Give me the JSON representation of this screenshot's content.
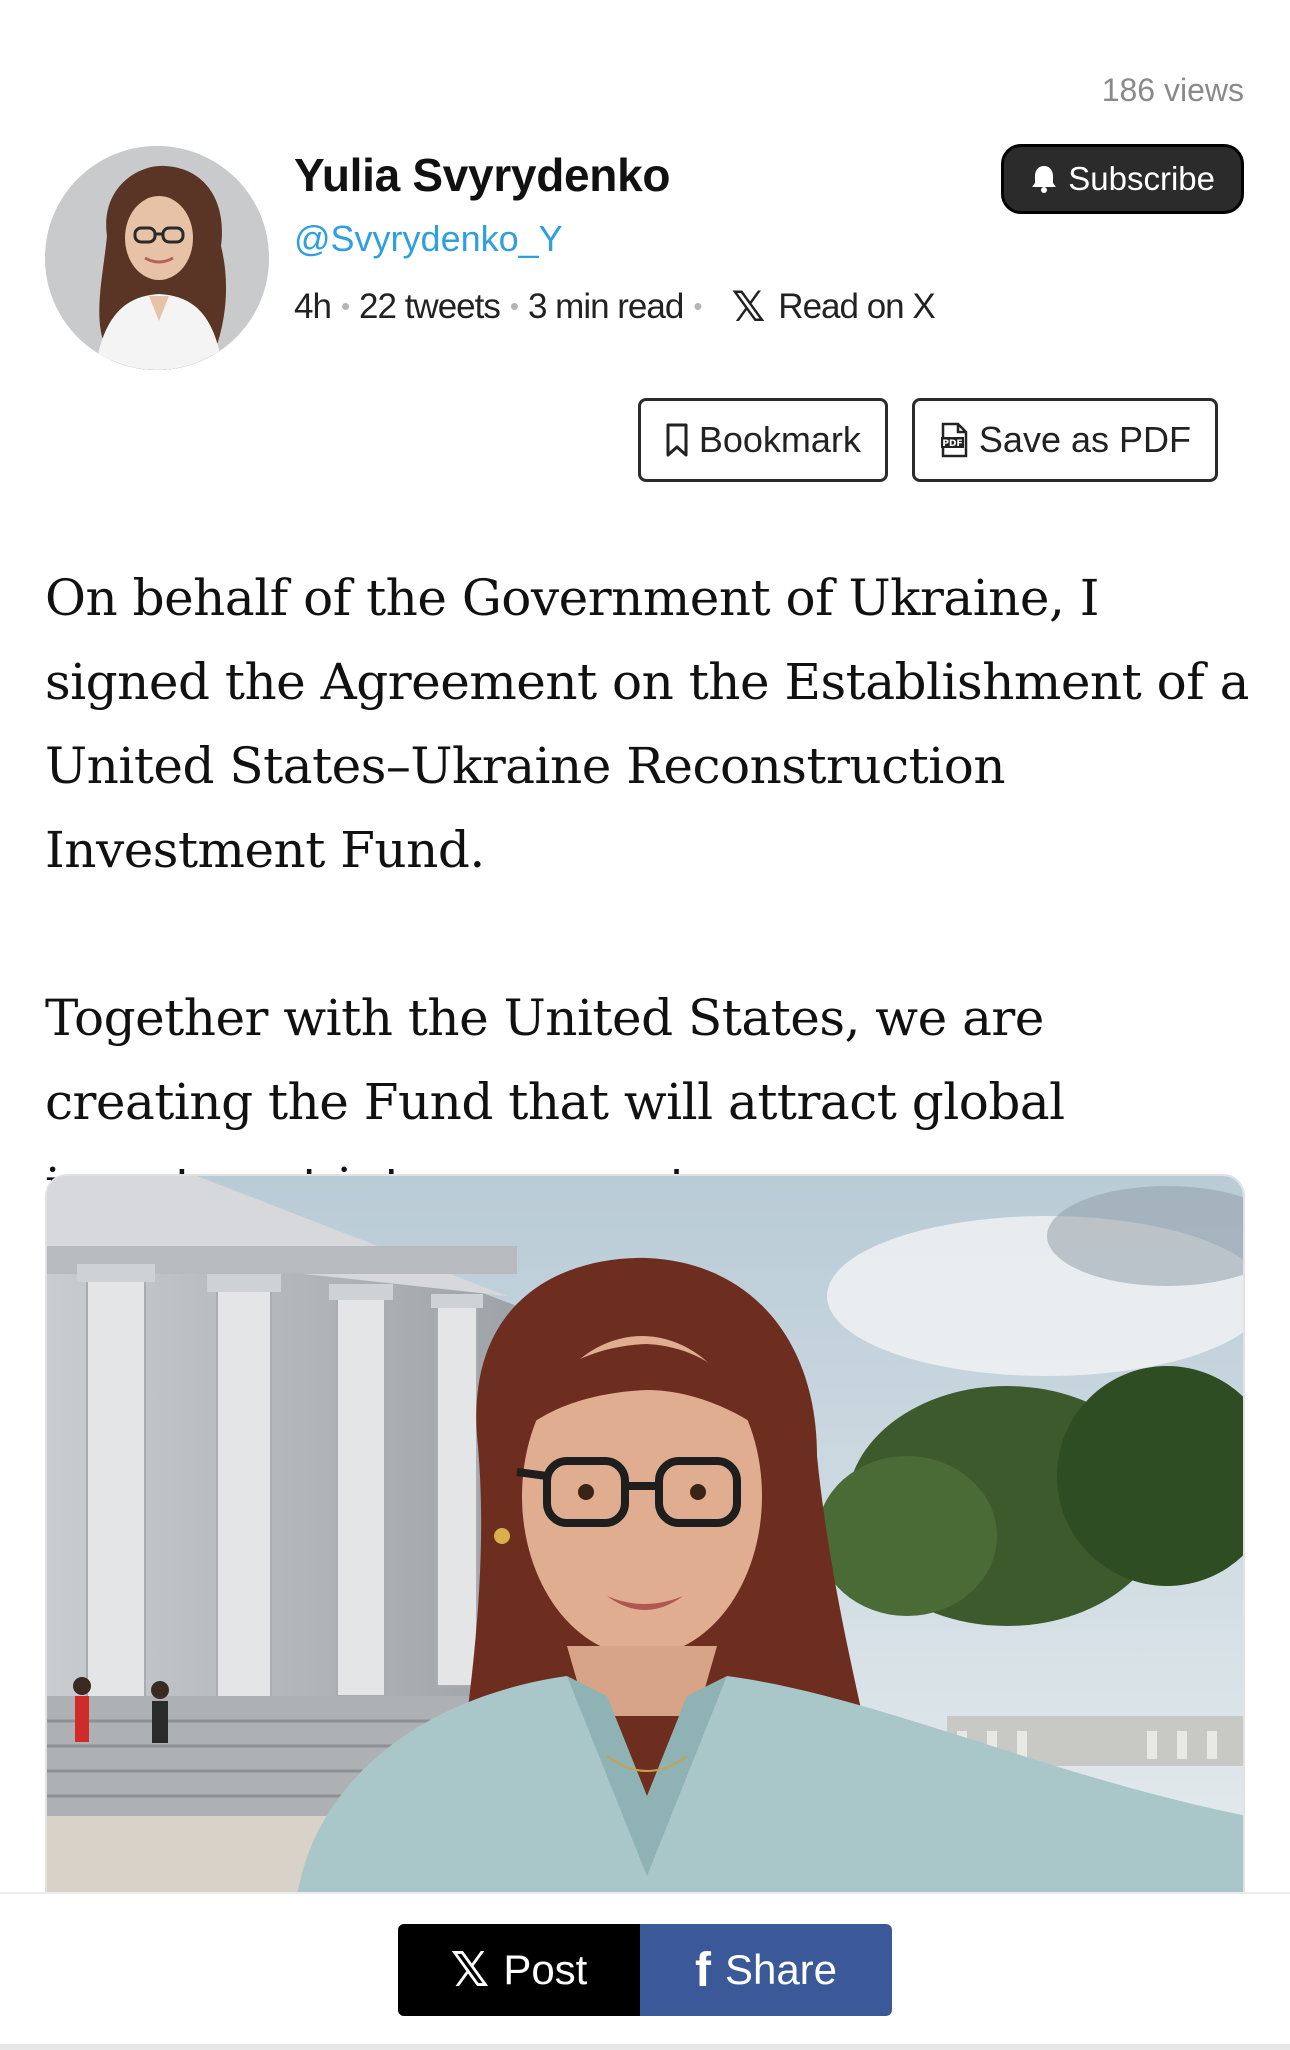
{
  "views": "186 views",
  "author": {
    "name": "Yulia Svyrydenko",
    "handle": "@Svyrydenko_Y",
    "time": "4h",
    "tweets": "22 tweets",
    "read_time": "3 min read",
    "read_on_x": "Read on X",
    "x_icon_glyph": "𝕏"
  },
  "subscribe": {
    "label": "Subscribe",
    "icon": "bell-icon"
  },
  "actions": {
    "bookmark": "Bookmark",
    "save_pdf": "Save as PDF"
  },
  "article": {
    "paragraphs": [
      "On behalf of the Government of Ukraine, I signed the Agreement on the Establishment of a United States–Ukraine Reconstruction Investment Fund.",
      "Together with the United States, we are creating the Fund that will attract global investment into our country."
    ]
  },
  "share": {
    "post_label": "Post",
    "post_glyph": "𝕏",
    "facebook_label": "Share",
    "facebook_glyph": "f"
  },
  "colors": {
    "handle": "#2f9fe0",
    "facebook": "#3b5998",
    "subscribe_bg": "#2b2b2b"
  }
}
